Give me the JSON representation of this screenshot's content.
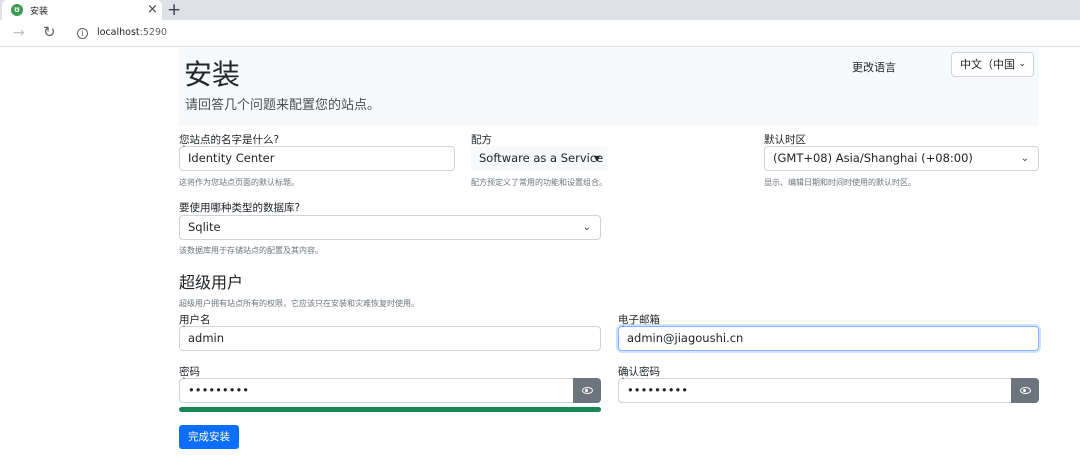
{
  "browser": {
    "tab_title": "安装",
    "tab_close": "×",
    "new_tab": "+",
    "url_host": "localhost",
    "url_port": ":5290"
  },
  "header": {
    "title": "安装",
    "subtitle": "请回答几个问题来配置您的站点。",
    "change_language_label": "更改语言",
    "language_value": "中文（中国"
  },
  "site": {
    "name_label": "您站点的名字是什么?",
    "name_value": "Identity Center",
    "name_hint": "这将作为您站点页面的默认标题。",
    "recipe_label": "配方",
    "recipe_value": "Software as a Service",
    "recipe_hint": "配方预定义了常用的功能和设置组合。",
    "timezone_label": "默认时区",
    "timezone_value": "(GMT+08) Asia/Shanghai (+08:00)",
    "timezone_hint": "显示、编辑日期和时间时使用的默认时区。",
    "db_label": "要使用哪种类型的数据库?",
    "db_value": "Sqlite",
    "db_hint": "该数据库用于存储站点的配置及其内容。"
  },
  "superuser": {
    "title": "超级用户",
    "hint": "超级用户拥有站点所有的权限，它应该只在安装和灾难恢复时使用。",
    "username_label": "用户名",
    "username_value": "admin",
    "email_label": "电子邮箱",
    "email_value": "admin@jiagoushi.cn",
    "password_label": "密码",
    "password_value": "•••••••••",
    "confirm_label": "确认密码",
    "confirm_value": "•••••••••",
    "password_strength": 1.0
  },
  "actions": {
    "submit_label": "完成安装"
  },
  "colors": {
    "primary": "#0d6efd",
    "success": "#198754",
    "secondary": "#6c757d"
  },
  "icons": [
    "favicon-icon",
    "close-icon",
    "plus-icon",
    "forward-icon",
    "reload-icon",
    "info-icon",
    "chevron-down-icon",
    "caret-down-icon",
    "eye-icon"
  ]
}
